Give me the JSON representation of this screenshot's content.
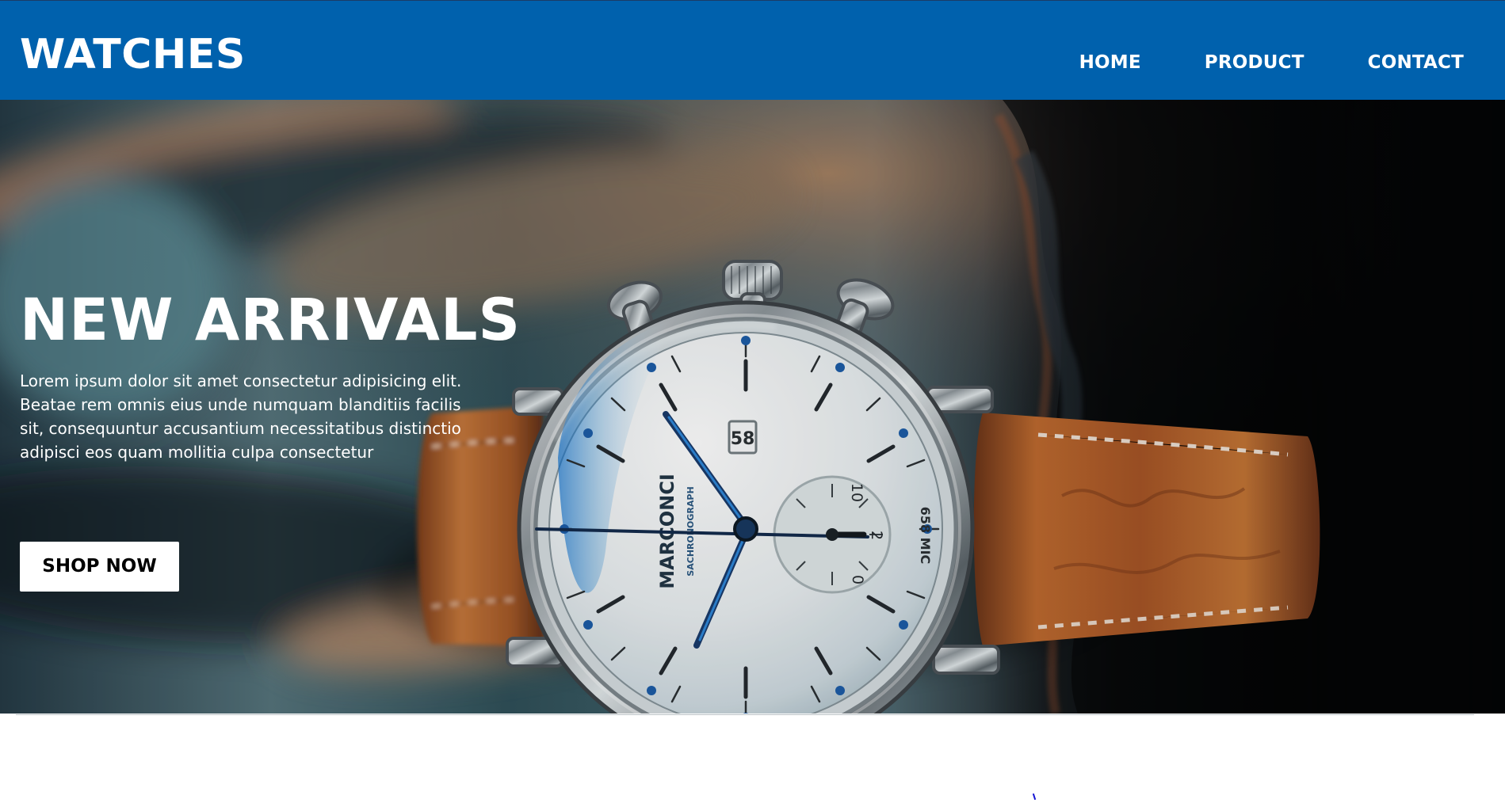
{
  "header": {
    "brand": "WATCHES",
    "nav": [
      {
        "label": "HOME"
      },
      {
        "label": "PRODUCT"
      },
      {
        "label": "CONTACT"
      }
    ]
  },
  "hero": {
    "title": "NEW ARRIVALS",
    "description": "Lorem ipsum dolor sit amet consectetur adipisicing elit. Beatae rem omnis eius unde numquam blanditiis facilis sit, consequuntur accusantium necessitatibus distinctio adipisci eos quam mollitia culpa consectetur",
    "button_label": "SHOP NOW",
    "image": {
      "watch_brand": "MARCONCI",
      "watch_subtitle": "SACHRONOGRAPH",
      "date_window": "58",
      "subdial_numbers": [
        "10",
        "2",
        "0"
      ],
      "bezel_text": "658 MIC"
    }
  },
  "colors": {
    "header": "#0061ad",
    "button_background": "#ffffff",
    "button_text": "#000000",
    "hero_text": "#ffffff",
    "watch_dial": "#eef2f4",
    "leather_strap": "#a95b25",
    "steel": "#c9d0d4",
    "watch_hand": "#1d4f89"
  }
}
